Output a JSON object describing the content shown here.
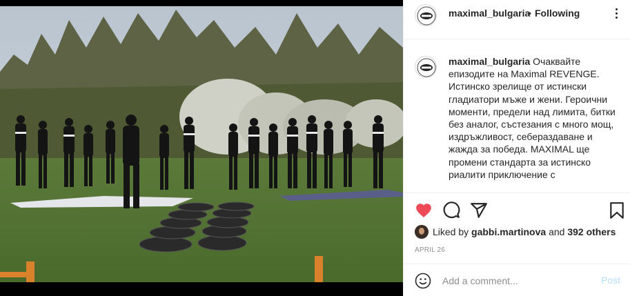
{
  "photo": {
    "icon": "post-photo-outdoor-group"
  },
  "header": {
    "username": "maximal_bulgaria",
    "separator": "•",
    "follow_status": "Following",
    "more_icon": "more-options-icon"
  },
  "caption": {
    "username": "maximal_bulgaria",
    "text": "Очаквайте епизодите на Maximal REVENGE. Истинско зрелище от истински гладиатори мъже и жени. Героични моменти, предели над лимита, битки без аналог, състезания с много мощ, издръжливост, себераздаване и жажда за победа. MAXIMAL ще промени стандарта за истинско риалити приключение с"
  },
  "actions": {
    "like_icon": "heart-filled-icon",
    "comment_icon": "comment-icon",
    "share_icon": "share-icon",
    "save_icon": "bookmark-icon",
    "like_color": "#ed4956"
  },
  "likes": {
    "prefix": "Liked by",
    "user": "gabbi.martinova",
    "middle": "and",
    "others": "392 others"
  },
  "date": "APRIL 26",
  "comment": {
    "placeholder": "Add a comment...",
    "post_label": "Post",
    "emoji_icon": "emoji-icon"
  }
}
